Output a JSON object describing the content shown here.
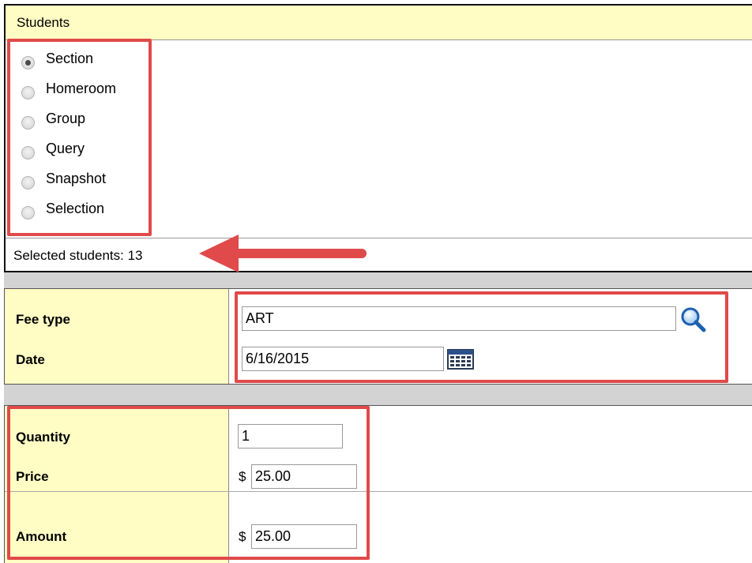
{
  "students": {
    "title": "Students",
    "options": [
      {
        "label": "Section",
        "selected": true
      },
      {
        "label": "Homeroom",
        "selected": false
      },
      {
        "label": "Group",
        "selected": false
      },
      {
        "label": "Query",
        "selected": false
      },
      {
        "label": "Snapshot",
        "selected": false
      },
      {
        "label": "Selection",
        "selected": false
      }
    ],
    "selected_count_text": "Selected students:  13"
  },
  "fee": {
    "fee_type_label": "Fee type",
    "fee_type_value": "ART",
    "date_label": "Date",
    "date_value": "6/16/2015"
  },
  "pricing": {
    "quantity_label": "Quantity",
    "quantity_value": "1",
    "price_label": "Price",
    "price_currency": "$",
    "price_value": "25.00",
    "amount_label": "Amount",
    "amount_currency": "$",
    "amount_value": "25.00"
  },
  "annotations": {
    "highlight_color": "#e04a4a",
    "header_bg": "#fffcc4"
  },
  "icons": {
    "lookup": "magnifier-icon",
    "calendar": "calendar-icon"
  }
}
